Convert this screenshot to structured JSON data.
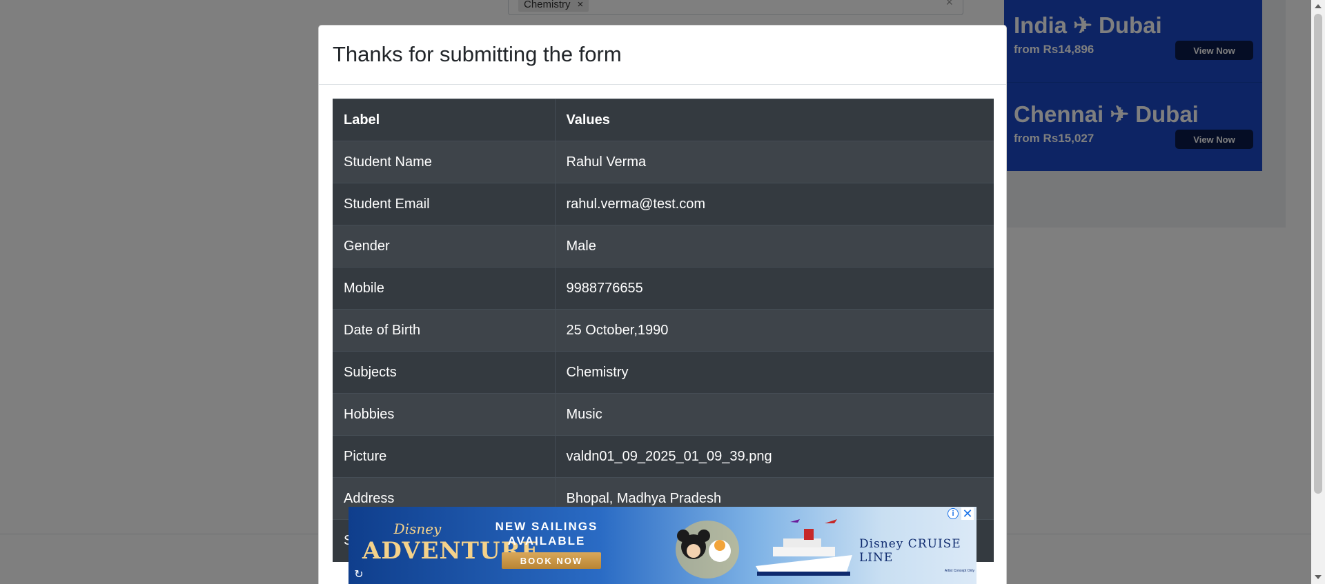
{
  "background": {
    "subject_chip": "Chemistry",
    "chip_remove": "×",
    "clear_all": "×"
  },
  "side_ad": {
    "routes": [
      {
        "title": "India ✈ Dubai",
        "price": "from Rs14,896",
        "cta": "View Now"
      },
      {
        "title": "Chennai ✈ Dubai",
        "price": "from Rs15,027",
        "cta": "View Now"
      }
    ]
  },
  "modal": {
    "title": "Thanks for submitting the form",
    "table": {
      "headers": [
        "Label",
        "Values"
      ],
      "rows": [
        [
          "Student Name",
          "Rahul Verma"
        ],
        [
          "Student Email",
          "rahul.verma@test.com"
        ],
        [
          "Gender",
          "Male"
        ],
        [
          "Mobile",
          "9988776655"
        ],
        [
          "Date of Birth",
          "25 October,1990"
        ],
        [
          "Subjects",
          "Chemistry"
        ],
        [
          "Hobbies",
          "Music"
        ],
        [
          "Picture",
          "valdn01_09_2025_01_09_39.png"
        ],
        [
          "Address",
          "Bhopal, Madhya Pradesh"
        ],
        [
          "S",
          ""
        ]
      ]
    }
  },
  "bottom_ad": {
    "brand_top": "Disney",
    "brand_main": "ADVENTURE",
    "headline": "NEW SAILINGS AVAILABLE",
    "cta": "BOOK NOW",
    "cruise_line": "Disney CRUISE LINE",
    "fine_print": "Artist Concept Only",
    "info_glyph": "i",
    "close_glyph": "✕",
    "refresh_glyph": "↻"
  },
  "colors": {
    "overlay": "rgba(0,0,0,0.5)",
    "table_dark": "#343a40",
    "table_stripe": "#3e444a",
    "side_ad_blue": "#1a49c8"
  },
  "icons": [
    "info-icon",
    "close-icon",
    "refresh-icon",
    "airplane-icon",
    "chip-remove-icon"
  ]
}
